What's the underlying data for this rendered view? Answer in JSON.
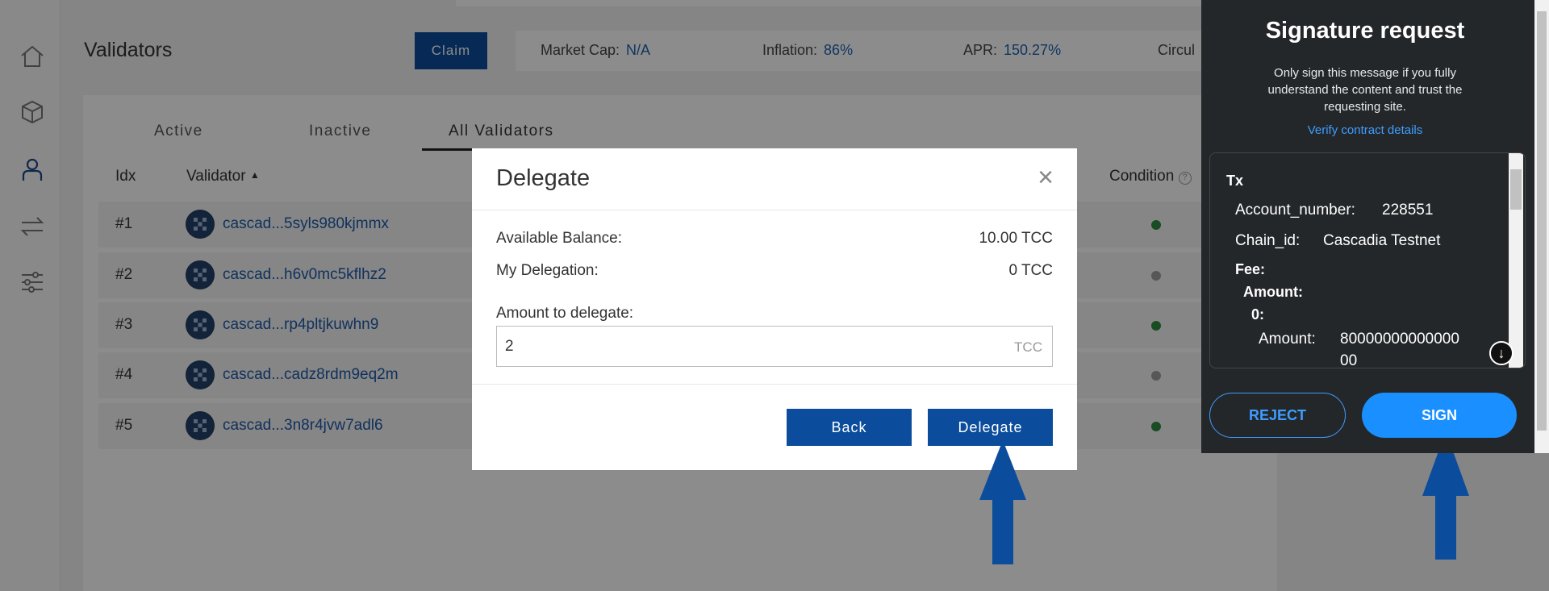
{
  "sidebar": {
    "items": [
      {
        "icon": "home-icon"
      },
      {
        "icon": "cube-icon"
      },
      {
        "icon": "user-icon"
      },
      {
        "icon": "transfer-icon"
      },
      {
        "icon": "sliders-icon"
      }
    ]
  },
  "header": {
    "title": "Validators",
    "claim_label": "Claim",
    "stats": [
      {
        "label": "Market Cap:",
        "value": "N/A"
      },
      {
        "label": "Inflation:",
        "value": "86%"
      },
      {
        "label": "APR:",
        "value": "150.27%"
      },
      {
        "label": "Circul",
        "value": ""
      }
    ]
  },
  "tabs": [
    {
      "label": "Active"
    },
    {
      "label": "Inactive"
    },
    {
      "label": "All Validators"
    }
  ],
  "table": {
    "headers": {
      "idx": "Idx",
      "validator": "Validator",
      "condition": "Condition"
    },
    "rows": [
      {
        "idx": "#1",
        "validator": "cascad...5syls980kjmmx",
        "status": "green"
      },
      {
        "idx": "#2",
        "validator": "cascad...h6v0mc5kflhz2",
        "status": "grey"
      },
      {
        "idx": "#3",
        "validator": "cascad...rp4pltjkuwhn9",
        "status": "green"
      },
      {
        "idx": "#4",
        "validator": "cascad...cadz8rdm9eq2m",
        "status": "grey"
      },
      {
        "idx": "#5",
        "validator": "cascad...3n8r4jvw7adl6",
        "status": "green"
      }
    ]
  },
  "modal": {
    "title": "Delegate",
    "available_label": "Available Balance:",
    "available_value": "10.00 TCC",
    "delegation_label": "My Delegation:",
    "delegation_value": "0 TCC",
    "amount_label": "Amount to delegate:",
    "amount_value": "2",
    "amount_unit": "TCC",
    "back_label": "Back",
    "delegate_label": "Delegate"
  },
  "signature": {
    "title": "Signature request",
    "description": "Only sign this message if you fully understand the content and trust the requesting site.",
    "verify_link": "Verify contract details",
    "tx": {
      "heading": "Tx",
      "account_number_label": "Account_number:",
      "account_number": "228551",
      "chain_id_label": "Chain_id:",
      "chain_id": "Cascadia Testnet",
      "fee_label": "Fee:",
      "amount_label": "Amount:",
      "zero_label": "0:",
      "inner_amount_label": "Amount:",
      "inner_amount_line1": "80000000000000",
      "inner_amount_line2": "00"
    },
    "reject_label": "REJECT",
    "sign_label": "SIGN"
  },
  "colors": {
    "primary": "#0b4d9c",
    "link": "#1e5aa8",
    "status_green": "#2e8b3e",
    "status_grey": "#9e9e9e",
    "sign_blue": "#1a8fff",
    "popup_bg": "#24272a"
  }
}
